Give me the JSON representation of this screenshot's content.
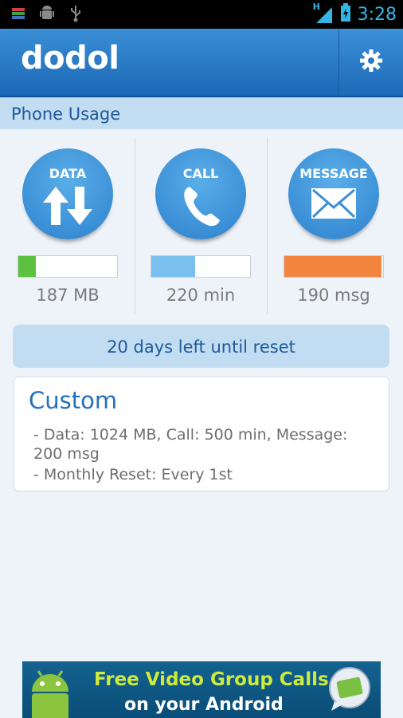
{
  "status_bar": {
    "time": "3:28",
    "network": "H",
    "icons_left": [
      "notification-icon",
      "android-debug-icon",
      "usb-icon"
    ],
    "icons_right": [
      "signal-icon",
      "battery-charging-icon"
    ]
  },
  "app_bar": {
    "logo": "dodol",
    "settings_icon": "gear-icon"
  },
  "section": {
    "title": "Phone Usage"
  },
  "usage": [
    {
      "label": "DATA",
      "icon": "data-arrows-icon",
      "value": "187 MB",
      "bar_fraction": 0.18,
      "bar_color": "#5cc040"
    },
    {
      "label": "CALL",
      "icon": "phone-icon",
      "value": "220 min",
      "bar_fraction": 0.44,
      "bar_color": "#79c0ee"
    },
    {
      "label": "MESSAGE",
      "icon": "envelope-icon",
      "value": "190 msg",
      "bar_fraction": 0.98,
      "bar_color": "#f4853f"
    }
  ],
  "reset": {
    "text": "20 days left until reset"
  },
  "plan": {
    "title": "Custom",
    "line1": " - Data: 1024 MB, Call: 500 min, Message: 200 msg",
    "line2": " - Monthly Reset: Every 1st"
  },
  "ad": {
    "line1": "Free Video Group Calls",
    "line2": "on your Android"
  },
  "colors": {
    "primary": "#1e6fc0",
    "accent": "#3b8fd6",
    "background": "#eef3f9"
  }
}
